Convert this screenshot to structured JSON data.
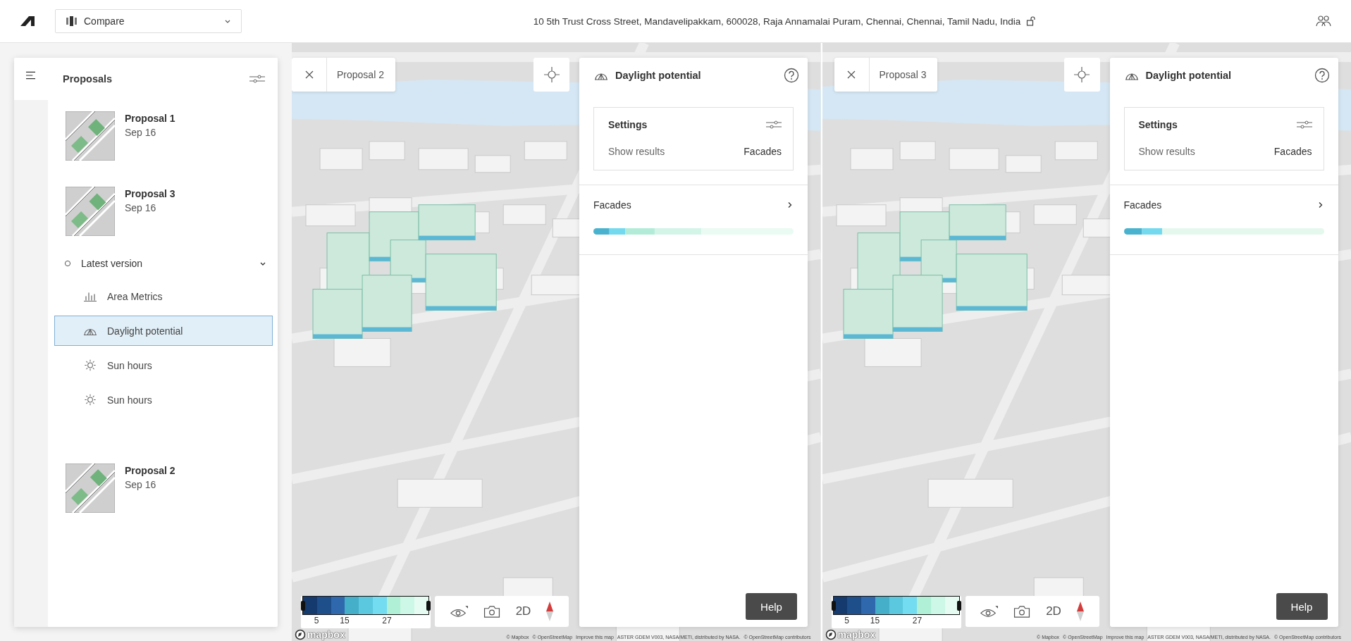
{
  "top_bar": {
    "view_mode": "Compare",
    "address": "10 5th Trust Cross Street, Mandavelipakkam, 600028, Raja Annamalai Puram, Chennai, Chennai, Tamil Nadu, India"
  },
  "sidebar": {
    "title": "Proposals",
    "proposals": [
      {
        "name": "Proposal 1",
        "date": "Sep 16"
      },
      {
        "name": "Proposal 3",
        "date": "Sep 16",
        "versions": [
          {
            "label": "Latest version",
            "expanded": true,
            "analyses": [
              {
                "label": "Area Metrics",
                "kind": "metrics",
                "selected": false
              },
              {
                "label": "Daylight potential",
                "kind": "daylight",
                "selected": true
              },
              {
                "label": "Sun hours",
                "kind": "sun",
                "selected": false
              },
              {
                "label": "Sun hours",
                "kind": "sun",
                "selected": false
              }
            ]
          }
        ]
      },
      {
        "name": "Proposal 2",
        "date": "Sep 16"
      }
    ]
  },
  "views": [
    {
      "proposal": "Proposal 2",
      "panel": {
        "title": "Daylight potential",
        "settings": {
          "title": "Settings",
          "label": "Show results",
          "value": "Facades"
        },
        "result": {
          "title": "Facades"
        },
        "help": "Help"
      },
      "legend": {
        "swatches": [
          {
            "color": "#143a6e"
          },
          {
            "color": "#1f4f8a",
            "label": "5"
          },
          {
            "color": "#2f68ad"
          },
          {
            "color": "#45afca",
            "label": "15"
          },
          {
            "color": "#5bc8df"
          },
          {
            "color": "#74dcf0"
          },
          {
            "color": "#aff0d6",
            "label": "27"
          },
          {
            "color": "#cdf7e6"
          },
          {
            "color": "#e6fcf2"
          }
        ]
      },
      "mode_button": "2D",
      "logo": "mapbox",
      "attribution": [
        "© Mapbox",
        "© OpenStreetMap",
        "Improve this map",
        "ASTER GDEM V003, NASA/METI, distributed by NASA.",
        "© OpenStreetMap contributors"
      ]
    },
    {
      "proposal": "Proposal 3",
      "panel": {
        "title": "Daylight potential",
        "settings": {
          "title": "Settings",
          "label": "Show results",
          "value": "Facades"
        },
        "result": {
          "title": "Facades"
        },
        "help": "Help"
      },
      "legend": {
        "swatches": [
          {
            "color": "#143a6e"
          },
          {
            "color": "#1f4f8a",
            "label": "5"
          },
          {
            "color": "#2f68ad"
          },
          {
            "color": "#45afca",
            "label": "15"
          },
          {
            "color": "#5bc8df"
          },
          {
            "color": "#74dcf0"
          },
          {
            "color": "#aff0d6",
            "label": "27"
          },
          {
            "color": "#cdf7e6"
          },
          {
            "color": "#e6fcf2"
          }
        ]
      },
      "mode_button": "2D",
      "logo": "mapbox",
      "attribution": [
        "© Mapbox",
        "© OpenStreetMap",
        "Improve this map",
        "ASTER GDEM V003, NASA/METI, distributed by NASA.",
        "© OpenStreetMap contributors"
      ]
    }
  ]
}
